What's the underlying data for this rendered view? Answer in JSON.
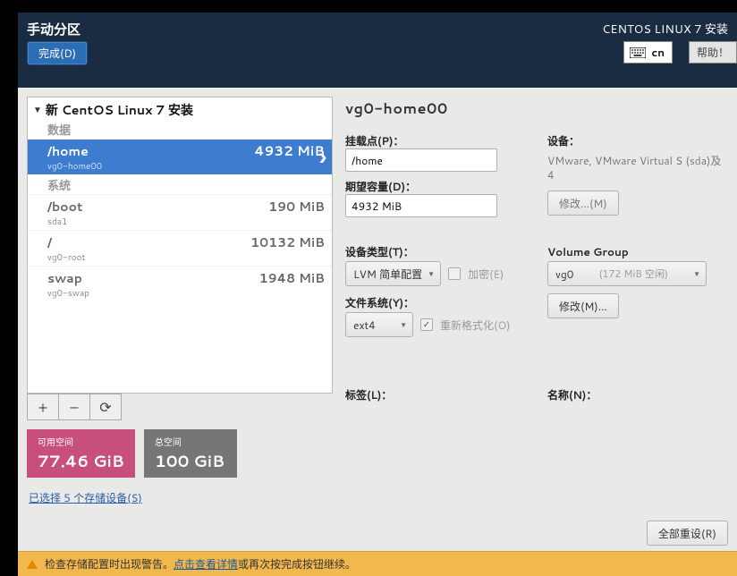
{
  "topbar": {
    "title": "手动分区",
    "done": "完成(D)",
    "right_title": "CENTOS LINUX 7 安装",
    "kb": "cn",
    "help": "帮助！"
  },
  "tree": {
    "header": "新 CentOS Linux 7 安装",
    "groups": [
      {
        "label": "数据",
        "items": [
          {
            "mount": "/home",
            "size": "4932 MiB",
            "dev": "vg0-home00",
            "selected": true
          }
        ]
      },
      {
        "label": "系统",
        "items": [
          {
            "mount": "/boot",
            "size": "190 MiB",
            "dev": "sda1"
          },
          {
            "mount": "/",
            "size": "10132 MiB",
            "dev": "vg0-root"
          },
          {
            "mount": "swap",
            "size": "1948 MiB",
            "dev": "vg0-swap"
          }
        ]
      }
    ]
  },
  "buttons": {
    "add": "+",
    "remove": "–",
    "reload": "⟳"
  },
  "storage": {
    "avail_lbl": "可用空间",
    "avail_val": "77.46 GiB",
    "total_lbl": "总空间",
    "total_val": "100 GiB",
    "devices_link": "已选择 5 个存储设备(S)"
  },
  "details": {
    "title": "vg0-home00",
    "mount_lbl": "挂载点(P)：",
    "mount_val": "/home",
    "cap_lbl": "期望容量(D)：",
    "cap_val": "4932 MiB",
    "device_lbl": "设备：",
    "device_txt": "VMware, VMware Virtual S (sda)及 4",
    "modify_btn": "修改...(M)",
    "type_lbl": "设备类型(T)：",
    "type_val": "LVM 简单配置",
    "encrypt_lbl": "加密(E)",
    "vg_lbl": "Volume Group",
    "vg_name": "vg0",
    "vg_free": "(172 MiB 空闲)",
    "vg_modify": "修改(M)...",
    "fs_lbl": "文件系统(Y)：",
    "fs_val": "ext4",
    "reformat_lbl": "重新格式化(O)",
    "label_lbl": "标签(L)：",
    "name_lbl": "名称(N)：",
    "reset": "全部重设(R)"
  },
  "warning": {
    "pre": "检查存储配置时出现警告。",
    "link": "点击查看详情",
    "post": "或再次按完成按钮继续。"
  }
}
